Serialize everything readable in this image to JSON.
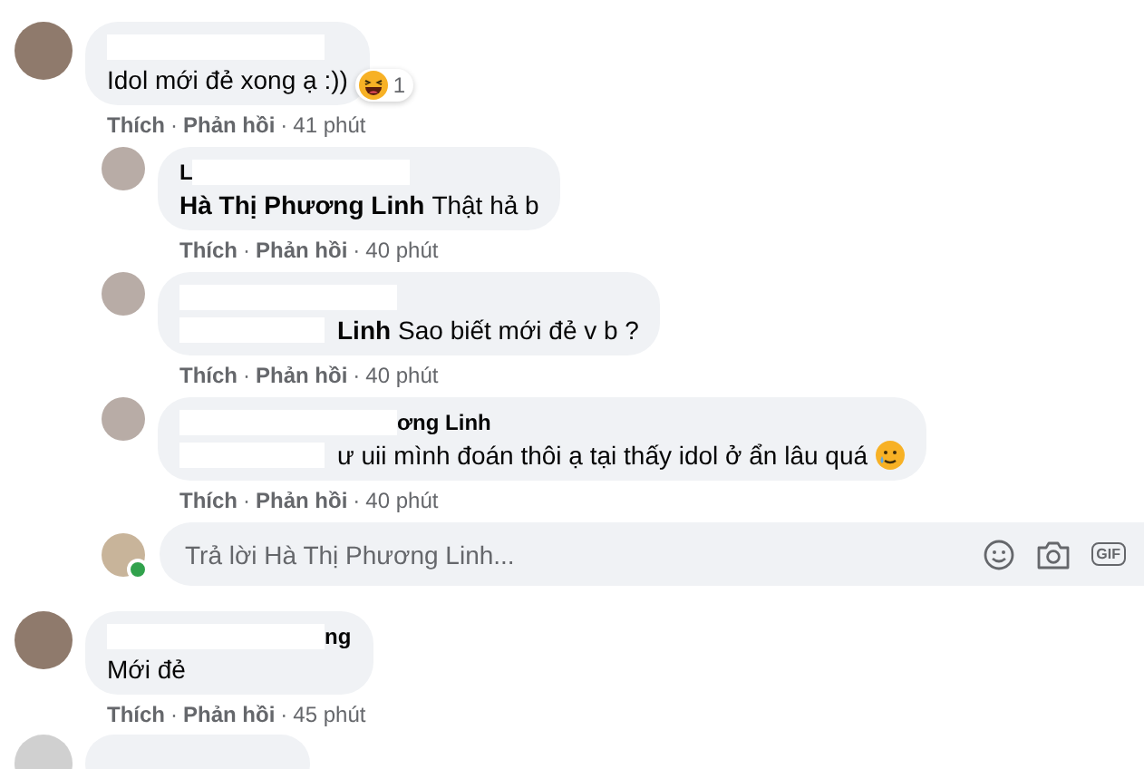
{
  "separator": "·",
  "comments": [
    {
      "name_parts": [
        {
          "kind": "redacted"
        }
      ],
      "body_parts": [
        {
          "kind": "text",
          "text": "Idol mới đẻ xong ạ :))"
        }
      ],
      "reaction_count": "1",
      "actions": [
        "Thích",
        "Phản hồi"
      ],
      "time": "41 phút",
      "replies": [
        {
          "name_parts": [
            {
              "kind": "text",
              "text": "L"
            },
            {
              "kind": "redacted"
            }
          ],
          "body_parts": [
            {
              "kind": "mention",
              "text": "Hà Thị Phương Linh"
            },
            {
              "kind": "text",
              "text": "Thật hả b"
            }
          ],
          "actions": [
            "Thích",
            "Phản hồi"
          ],
          "time": "40 phút"
        },
        {
          "name_parts": [
            {
              "kind": "redacted"
            }
          ],
          "body_parts": [
            {
              "kind": "redacted"
            },
            {
              "kind": "mention",
              "text": "Linh"
            },
            {
              "kind": "text",
              "text": "Sao biết mới đẻ v b ?"
            }
          ],
          "actions": [
            "Thích",
            "Phản hồi"
          ],
          "time": "40 phút"
        },
        {
          "name_parts": [
            {
              "kind": "redacted"
            },
            {
              "kind": "text",
              "text": "ơng Linh"
            }
          ],
          "body_parts": [
            {
              "kind": "redacted"
            },
            {
              "kind": "text",
              "text": "ư uii mình đoán thôi ạ tại thấy idol ở ẩn lâu quá"
            },
            {
              "kind": "emoji"
            }
          ],
          "actions": [
            "Thích",
            "Phản hồi"
          ],
          "time": "40 phút"
        }
      ],
      "reply_box": {
        "placeholder": "Trả lời Hà Thị Phương Linh...",
        "online": true,
        "gif_label": "GIF"
      }
    },
    {
      "name_parts": [
        {
          "kind": "redacted"
        },
        {
          "kind": "text",
          "text": "ng"
        }
      ],
      "body_parts": [
        {
          "kind": "text",
          "text": "Mới đẻ"
        }
      ],
      "actions": [
        "Thích",
        "Phản hồi"
      ],
      "time": "45 phút"
    }
  ]
}
